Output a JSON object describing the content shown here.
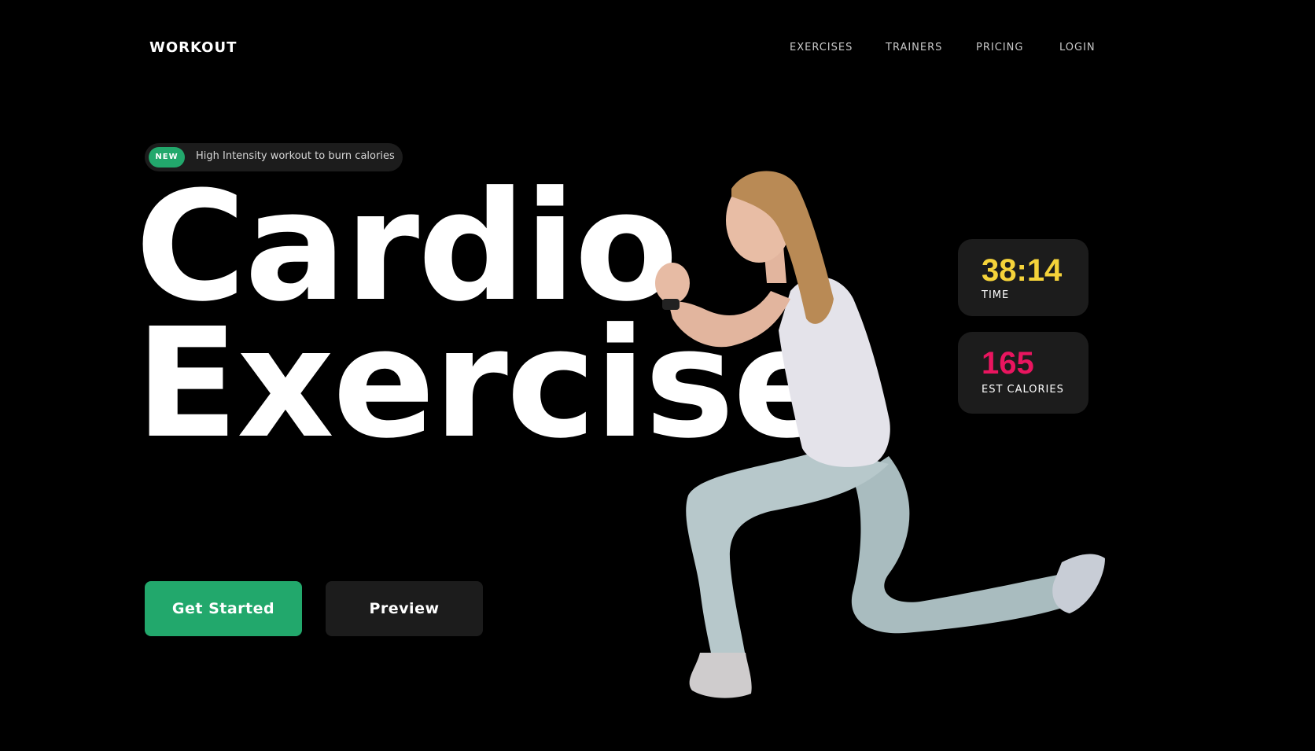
{
  "header": {
    "logo": "WORKOUT",
    "nav": [
      "EXERCISES",
      "TRAINERS",
      "PRICING",
      "LOGIN"
    ]
  },
  "hero": {
    "badge": {
      "tag": "NEW",
      "text": "High Intensity workout to burn calories"
    },
    "title_line1": "Cardio",
    "title_line2": "Exercise",
    "primary_button": "Get Started",
    "secondary_button": "Preview"
  },
  "stats": {
    "time": {
      "value": "38:14",
      "label": "TIME"
    },
    "calories": {
      "value": "165",
      "label": "EST CALORIES"
    }
  },
  "colors": {
    "accent": "#22a86c",
    "time_value": "#f5d33a",
    "calories_value": "#e9155f",
    "card_bg": "#1c1c1c"
  }
}
